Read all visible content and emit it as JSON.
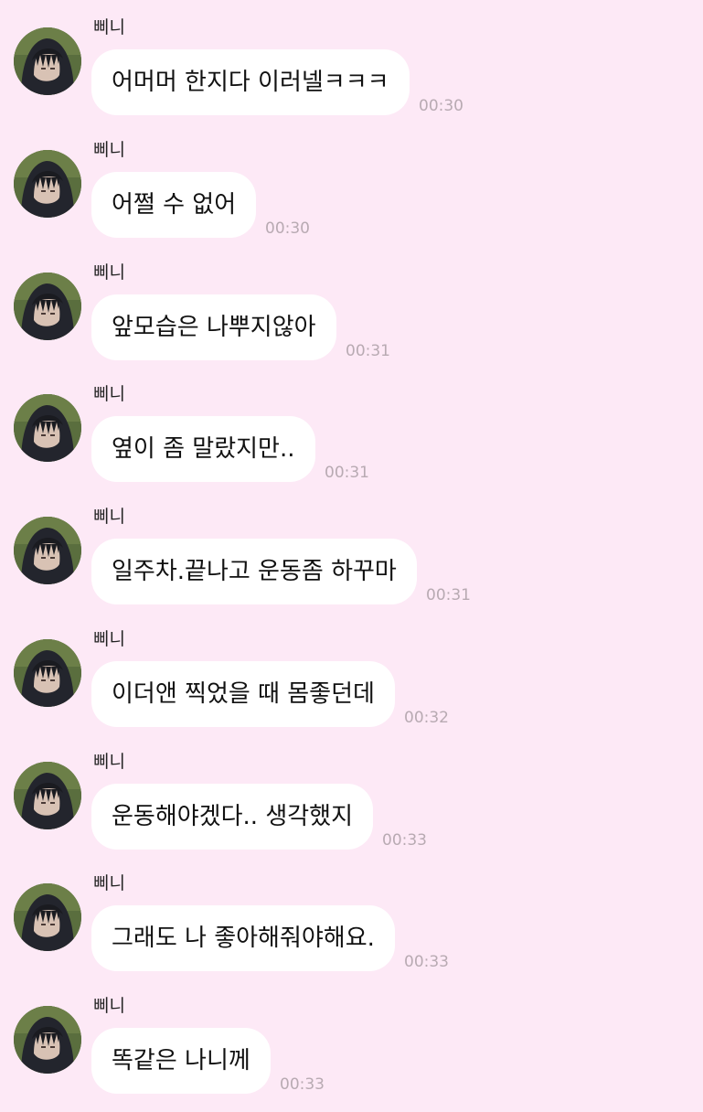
{
  "sender_name": "삐니",
  "avatar_icon": "profile-photo-person-in-dark-hood",
  "colors": {
    "background": "#fde9f6",
    "bubble": "#ffffff",
    "timestamp": "#b8aab2"
  },
  "messages": [
    {
      "text": "어머머 한지다 이러넬ㅋㅋㅋ",
      "time": "00:30"
    },
    {
      "text": "어쩔 수 없어",
      "time": "00:30"
    },
    {
      "text": "앞모습은 나뿌지않아",
      "time": "00:31"
    },
    {
      "text": "옆이 좀 말랐지만..",
      "time": "00:31"
    },
    {
      "text": "일주차.끝나고 운동좀 하꾸마",
      "time": "00:31"
    },
    {
      "text": "이더앤 찍었을 때 몸좋던데",
      "time": "00:32"
    },
    {
      "text": "운동해야겠다.. 생각했지",
      "time": "00:33"
    },
    {
      "text": "그래도 나 좋아해줘야해요.",
      "time": "00:33"
    },
    {
      "text": "똑같은 나니께",
      "time": "00:33"
    }
  ]
}
